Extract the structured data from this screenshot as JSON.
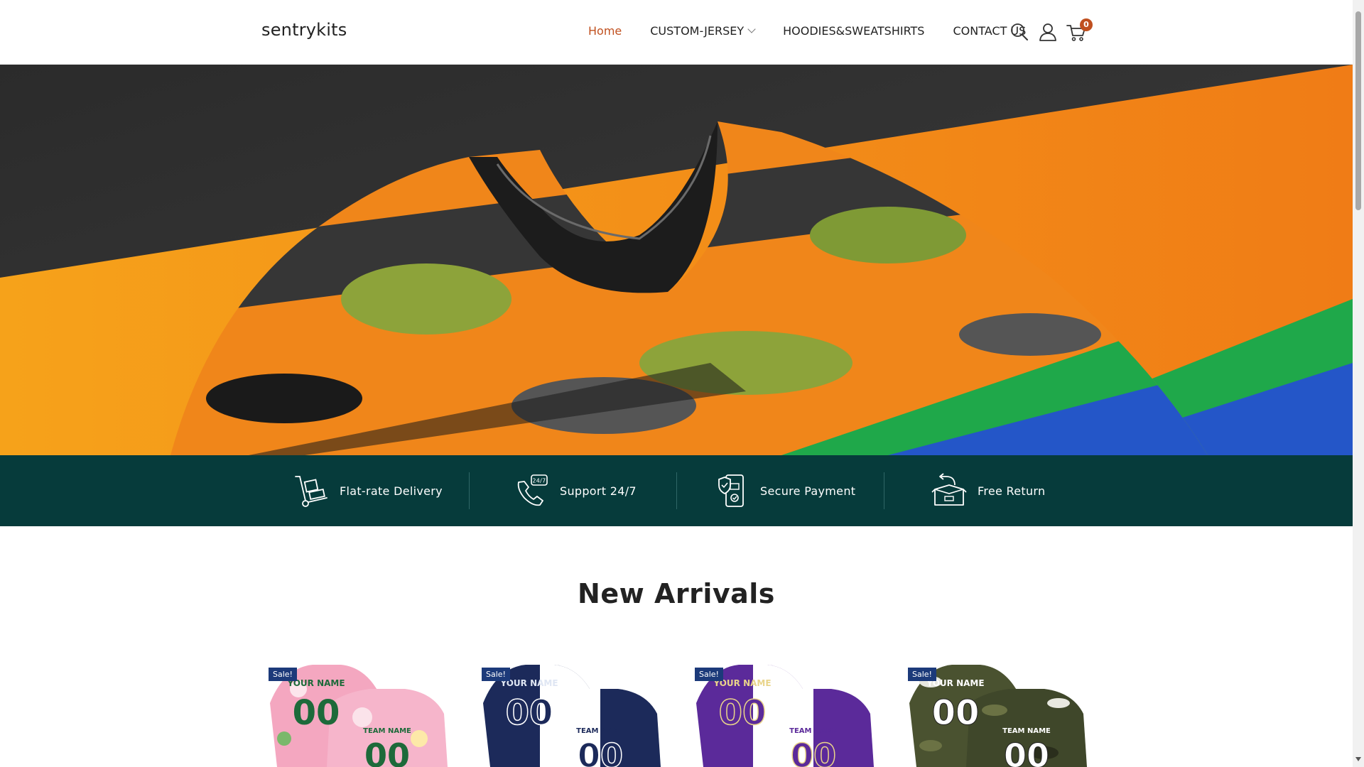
{
  "brand": {
    "name": "sentrykits",
    "accent_color": "#c0501f",
    "feature_bar_color": "#063b3b"
  },
  "nav": {
    "items": [
      {
        "label": "Home",
        "active": true
      },
      {
        "label": "CUSTOM-JERSEY",
        "has_dropdown": true
      },
      {
        "label": "HOODIES&SWEATSHIRTS"
      },
      {
        "label": "CONTACT US"
      }
    ]
  },
  "header_icons": {
    "search": "search-icon",
    "account": "user-icon",
    "cart": "cart-icon",
    "cart_count": "0"
  },
  "features": [
    {
      "label": "Flat-rate Delivery",
      "icon": "hand-truck-icon"
    },
    {
      "label": "Support 24/7",
      "icon": "phone-24-7-icon"
    },
    {
      "label": "Secure Payment",
      "icon": "secure-payment-icon"
    },
    {
      "label": "Free Return",
      "icon": "return-box-icon"
    }
  ],
  "new_arrivals": {
    "title": "New Arrivals",
    "products": [
      {
        "badge": "Sale!",
        "theme": "pink-floral",
        "text_top": "YOUR NAME",
        "text_bottom": "TEAM NAME",
        "number": "00"
      },
      {
        "badge": "Sale!",
        "theme": "navy-white",
        "text_top": "YOUR NAME",
        "text_bottom": "TEAM NAME",
        "number": "00"
      },
      {
        "badge": "Sale!",
        "theme": "purple-white",
        "text_top": "YOUR NAME",
        "text_bottom": "TEAM NAME",
        "number": "00"
      },
      {
        "badge": "Sale!",
        "theme": "camo",
        "text_top": "YOUR NAME",
        "text_bottom": "TEAM NAME",
        "number": "00"
      }
    ]
  }
}
